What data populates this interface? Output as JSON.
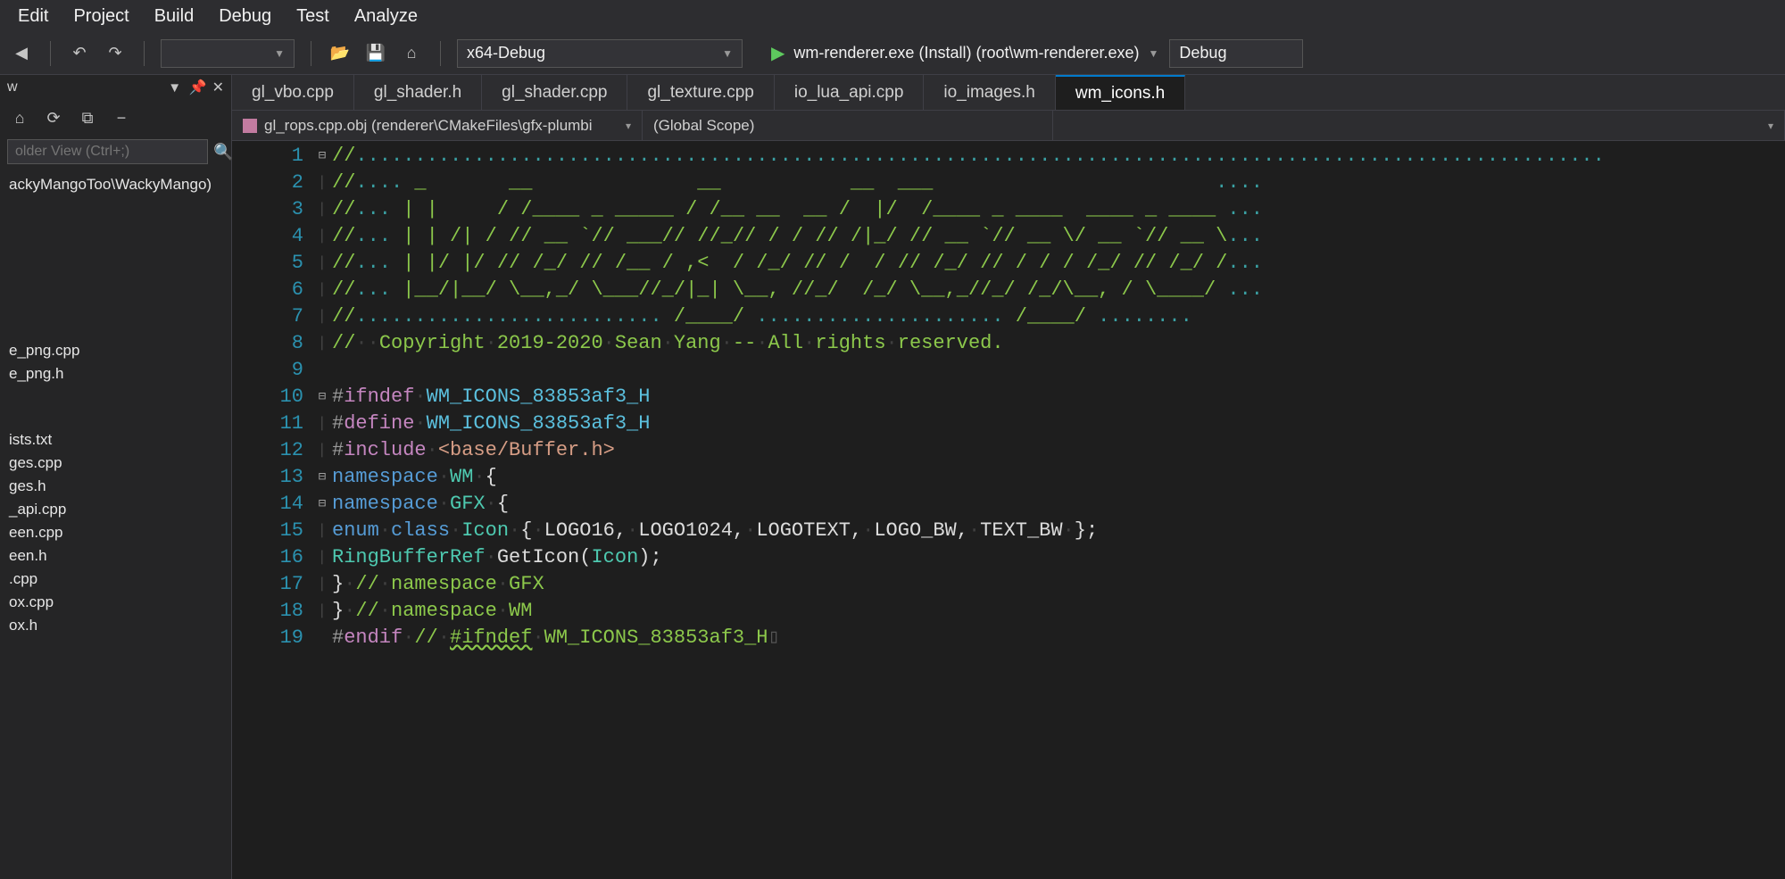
{
  "menubar": [
    "Edit",
    "Project",
    "Build",
    "Debug",
    "Test",
    "Analyze"
  ],
  "toolbar": {
    "config_dropdown_empty": "",
    "platform": "x64-Debug",
    "run_target": "wm-renderer.exe (Install) (root\\wm-renderer.exe)",
    "run_config": "Debug"
  },
  "left_panel": {
    "title": "w",
    "search_placeholder": "older View (Ctrl+;)",
    "root": "ackyMangoToo\\WackyMango)",
    "files": [
      "e_png.cpp",
      "e_png.h",
      "",
      "ists.txt",
      "ges.cpp",
      "ges.h",
      "_api.cpp",
      "een.cpp",
      "een.h",
      ".cpp",
      "ox.cpp",
      "ox.h"
    ]
  },
  "tabs": [
    {
      "name": "gl_vbo.cpp",
      "active": false
    },
    {
      "name": "gl_shader.h",
      "active": false
    },
    {
      "name": "gl_shader.cpp",
      "active": false
    },
    {
      "name": "gl_texture.cpp",
      "active": false
    },
    {
      "name": "io_lua_api.cpp",
      "active": false
    },
    {
      "name": "io_images.h",
      "active": false
    },
    {
      "name": "wm_icons.h",
      "active": true
    }
  ],
  "nav": {
    "left": "gl_rops.cpp.obj (renderer\\CMakeFiles\\gfx-plumbi",
    "scope": "(Global Scope)"
  },
  "code": {
    "lines": [
      {
        "n": 1,
        "fold": "box",
        "html": "<span class='c-comment'>//<span class='c-dots'>..........................................................................................................</span></span>"
      },
      {
        "n": 2,
        "fold": "line",
        "html": "<span class='c-comment'>//<span class='c-dots'>....</span> _       __              __           __  ___                        <span class='c-dots'>....</span></span>"
      },
      {
        "n": 3,
        "fold": "line",
        "html": "<span class='c-comment'>//<span class='c-dots'>...</span> | |     / /____ _ _____ / /__ __  __ /  |/  /____ _ ____  ____ _ ____ <span class='c-dots'>...</span></span>"
      },
      {
        "n": 4,
        "fold": "line",
        "html": "<span class='c-comment'>//<span class='c-dots'>...</span> | | /| / // __ `// ___// //_// / / // /|_/ // __ `// __ \\/ __ `// __ \\<span class='c-dots'>...</span></span>"
      },
      {
        "n": 5,
        "fold": "line",
        "html": "<span class='c-comment'>//<span class='c-dots'>...</span> | |/ |/ // /_/ // /__ / ,<  / /_/ // /  / // /_/ // / / / /_/ // /_/ /<span class='c-dots'>...</span></span>"
      },
      {
        "n": 6,
        "fold": "line",
        "html": "<span class='c-comment'>//<span class='c-dots'>...</span> |__/|__/ \\__,_/ \\___//_/|_| \\__, //_/  /_/ \\__,_//_/ /_/\\__, / \\____/ <span class='c-dots'>...</span></span>"
      },
      {
        "n": 7,
        "fold": "line",
        "html": "<span class='c-comment'>//<span class='c-dots'>..........................</span> /____/ <span class='c-dots'>.....................</span> /____/ <span class='c-dots'>........</span></span>"
      },
      {
        "n": 8,
        "fold": "line",
        "html": "<span class='c-comment'>//<span class='ws-dot'>··</span>Copyright<span class='ws-dot'>·</span>2019-2020<span class='ws-dot'>·</span>Sean<span class='ws-dot'>·</span>Yang<span class='ws-dot'>·</span>--<span class='ws-dot'>·</span>All<span class='ws-dot'>·</span>rights<span class='ws-dot'>·</span>reserved.</span>"
      },
      {
        "n": 9,
        "fold": "",
        "html": ""
      },
      {
        "n": 10,
        "fold": "box",
        "html": "<span class='c-pre'>#<span class='c-pre-kw'>ifndef</span><span class='ws-dot'>·</span><span class='c-macro'>WM_ICONS_83853af3_H</span></span>"
      },
      {
        "n": 11,
        "fold": "line",
        "html": "<span class='c-pre'>#<span class='c-pre-kw'>define</span><span class='ws-dot'>·</span><span class='c-macro'>WM_ICONS_83853af3_H</span></span>"
      },
      {
        "n": 12,
        "fold": "line",
        "html": "<span class='c-pre'>#<span class='c-pre-kw'>include</span><span class='ws-dot'>·</span><span class='c-str'>&lt;base/Buffer.h&gt;</span></span>"
      },
      {
        "n": 13,
        "fold": "box",
        "html": "<span class='c-kw'>namespace</span><span class='ws-dot'>·</span><span class='c-type'>WM</span><span class='ws-dot'>·</span><span class='c-brace'>{</span>"
      },
      {
        "n": 14,
        "fold": "box",
        "html": "<span class='c-kw'>namespace</span><span class='ws-dot'>·</span><span class='c-type'>GFX</span><span class='ws-dot'>·</span><span class='c-brace'>{</span>"
      },
      {
        "n": 15,
        "fold": "line",
        "html": "<span class='c-kw'>enum</span><span class='ws-dot'>·</span><span class='c-kw'>class</span><span class='ws-dot'>·</span><span class='c-type'>Icon</span><span class='ws-dot'>·</span><span class='c-brace'>{</span><span class='ws-dot'>·</span>LOGO16,<span class='ws-dot'>·</span>LOGO1024,<span class='ws-dot'>·</span>LOGOTEXT,<span class='ws-dot'>·</span>LOGO_BW,<span class='ws-dot'>·</span>TEXT_BW<span class='ws-dot'>·</span><span class='c-brace'>}</span>;"
      },
      {
        "n": 16,
        "fold": "line",
        "html": "<span class='c-type'>RingBufferRef</span><span class='ws-dot'>·</span>GetIcon(<span class='c-type'>Icon</span>);"
      },
      {
        "n": 17,
        "fold": "line",
        "html": "<span class='c-brace'>}</span><span class='ws-dot'>·</span><span class='c-comment'>//<span class='ws-dot'>·</span>namespace<span class='ws-dot'>·</span>GFX</span>"
      },
      {
        "n": 18,
        "fold": "line",
        "html": "<span class='c-brace'>}</span><span class='ws-dot'>·</span><span class='c-comment'>//<span class='ws-dot'>·</span>namespace<span class='ws-dot'>·</span>WM</span>"
      },
      {
        "n": 19,
        "fold": "",
        "html": "<span class='c-pre'>#<span class='c-pre-kw'>endif</span></span><span class='ws-dot'>·</span><span class='c-comment'>//<span class='ws-dot'>·</span><span class='squig'>#ifndef</span><span class='ws-dot'>·</span>WM_ICONS_83853af3_H</span><span style='color:#555'>▯</span>"
      }
    ]
  }
}
